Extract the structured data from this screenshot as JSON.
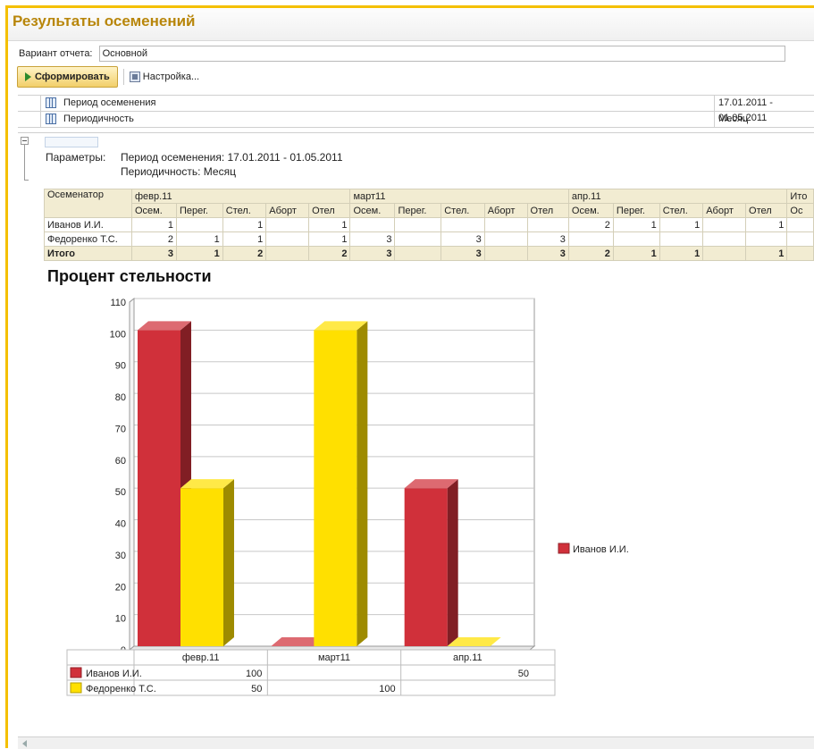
{
  "window": {
    "title": "Результаты осеменений"
  },
  "variant": {
    "label": "Вариант отчета:",
    "value": "Основной"
  },
  "toolbar": {
    "generate_label": "Сформировать",
    "settings_label": "Настройка..."
  },
  "parameters": [
    {
      "name": "Период осеменения",
      "value": "17.01.2011 - 01.05.2011"
    },
    {
      "name": "Периодичность",
      "value": "Месяц"
    }
  ],
  "report": {
    "params_label": "Параметры:",
    "params_line1": "Период осеменения: 17.01.2011 - 01.05.2011",
    "params_line2": "Периодичность: Месяц",
    "col_inseminator": "Осеменатор",
    "months": [
      "февр.11",
      "март11",
      "апр.11"
    ],
    "total_label_cut": "Ито",
    "subcols": [
      "Осем.",
      "Перег.",
      "Стел.",
      "Аборт",
      "Отел"
    ],
    "subcol_cut": "Ос",
    "rows": [
      {
        "name": "Иванов И.И.",
        "values": [
          "1",
          "",
          "1",
          "",
          "1",
          "",
          "",
          "",
          "",
          "",
          "2",
          "1",
          "1",
          "",
          "1"
        ]
      },
      {
        "name": "Федоренко Т.С.",
        "values": [
          "2",
          "1",
          "1",
          "",
          "1",
          "3",
          "",
          "3",
          "",
          "3",
          "",
          "",
          "",
          "",
          ""
        ]
      }
    ],
    "total_row": {
      "name": "Итого",
      "values": [
        "3",
        "1",
        "2",
        "",
        "2",
        "3",
        "",
        "3",
        "",
        "3",
        "2",
        "1",
        "1",
        "",
        "1"
      ]
    }
  },
  "chart_data": {
    "type": "bar",
    "title": "Процент стельности",
    "categories": [
      "февр.11",
      "март11",
      "апр.11"
    ],
    "series": [
      {
        "name": "Иванов И.И.",
        "values": [
          100,
          0,
          50
        ],
        "table_values": [
          "100",
          "",
          "50"
        ],
        "color": "#d0303a"
      },
      {
        "name": "Федоренко Т.С.",
        "values": [
          50,
          100,
          0
        ],
        "table_values": [
          "50",
          "100",
          ""
        ],
        "color": "#ffe000"
      }
    ],
    "ylim": [
      0,
      110
    ],
    "yticks": [
      "0",
      "10",
      "20",
      "30",
      "40",
      "50",
      "60",
      "70",
      "80",
      "90",
      "100",
      "110"
    ],
    "grid": true,
    "legend": "right"
  }
}
